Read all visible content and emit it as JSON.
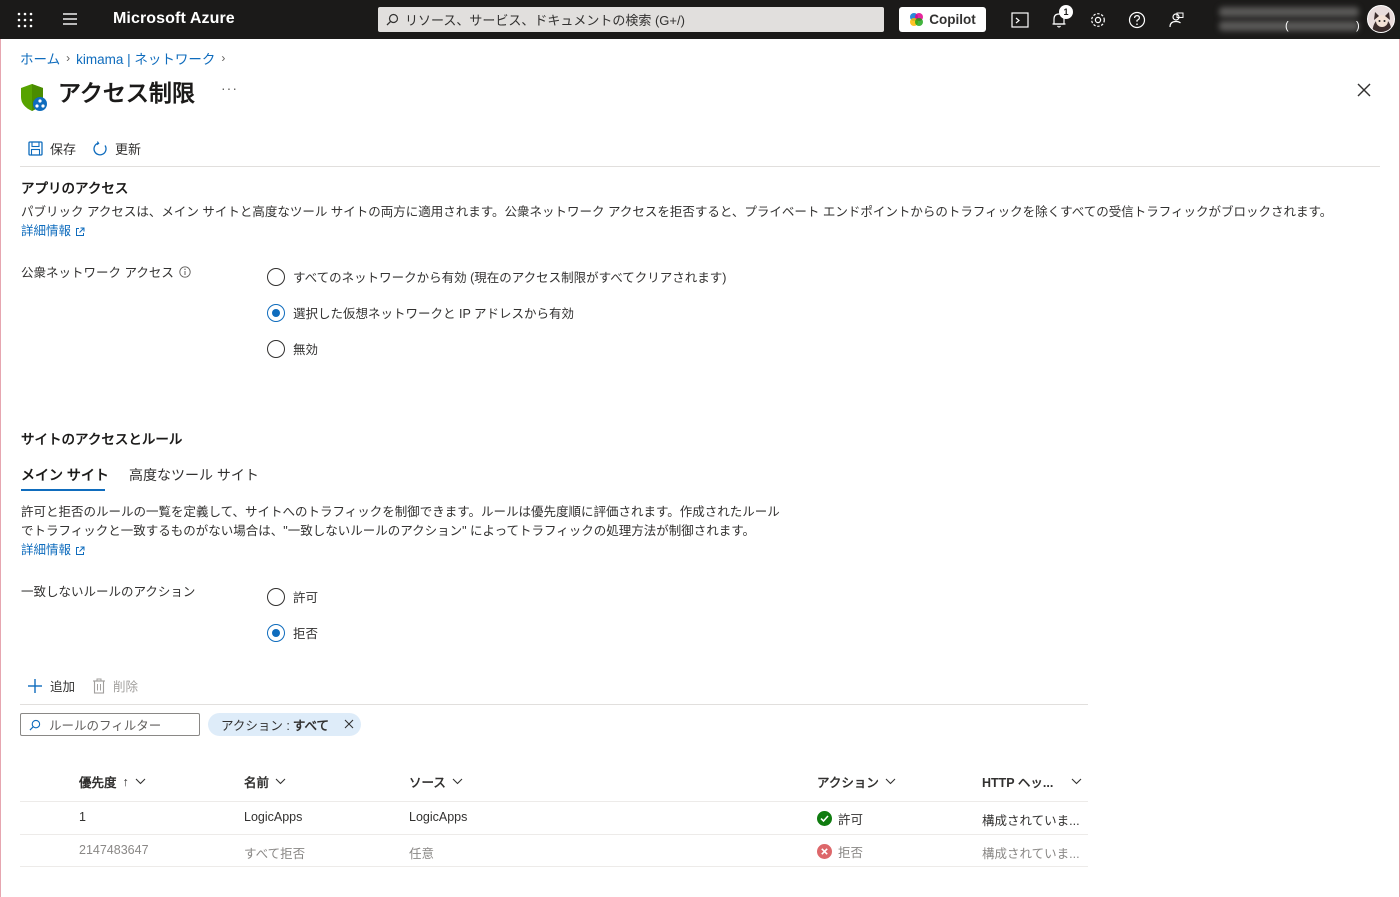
{
  "topbar": {
    "brand": "Microsoft Azure",
    "search_placeholder": "リソース、サービス、ドキュメントの検索 (G+/)",
    "copilot_label": "Copilot",
    "notification_count": "1",
    "paren_open": "(",
    "paren_close": ")"
  },
  "breadcrumb": {
    "home": "ホーム",
    "parent": "kimama | ネットワーク"
  },
  "page": {
    "title": "アクセス制限",
    "more": "···"
  },
  "toolbar": {
    "save_label": "保存",
    "refresh_label": "更新"
  },
  "app_access": {
    "heading": "アプリのアクセス",
    "description": "パブリック アクセスは、メイン サイトと高度なツール サイトの両方に適用されます。公衆ネットワーク アクセスを拒否すると、プライベート エンドポイントからのトラフィックを除くすべての受信トラフィックがブロックされます。",
    "learn_more": "詳細情報",
    "field_label": "公衆ネットワーク アクセス",
    "options": [
      {
        "label": "すべてのネットワークから有効 (現在のアクセス制限がすべてクリアされます)",
        "checked": false
      },
      {
        "label": "選択した仮想ネットワークと IP アドレスから有効",
        "checked": true
      },
      {
        "label": "無効",
        "checked": false
      }
    ]
  },
  "site_access": {
    "heading": "サイトのアクセスとルール",
    "tabs": [
      {
        "label": "メイン サイト",
        "active": true
      },
      {
        "label": "高度なツール サイト",
        "active": false
      }
    ],
    "description_line1": "許可と拒否のルールの一覧を定義して、サイトへのトラフィックを制御できます。ルールは優先度順に評価されます。作成されたルール",
    "description_line2": "でトラフィックと一致するものがない場合は、\"一致しないルールのアクション\" によってトラフィックの処理方法が制御されます。",
    "learn_more": "詳細情報",
    "unmatched_label": "一致しないルールのアクション",
    "unmatched_options": [
      {
        "label": "許可",
        "checked": false
      },
      {
        "label": "拒否",
        "checked": true
      }
    ]
  },
  "rules": {
    "add_label": "追加",
    "delete_label": "削除",
    "filter_placeholder": "ルールのフィルター",
    "pill_key": "アクション :",
    "pill_value": "すべて",
    "columns": {
      "priority": "優先度",
      "priority_sort": "↑",
      "name": "名前",
      "source": "ソース",
      "action": "アクション",
      "http": "HTTP ヘッ..."
    },
    "rows": [
      {
        "priority": "1",
        "name": "LogicApps",
        "source": "LogicApps",
        "action": "許可",
        "action_type": "allow",
        "http": "構成されていま..."
      },
      {
        "priority": "2147483647",
        "name": "すべて拒否",
        "source": "任意",
        "action": "拒否",
        "action_type": "deny",
        "http": "構成されていま..."
      }
    ]
  },
  "colors": {
    "accent": "#0f6cbd",
    "topbar": "#1b1a19",
    "allow": "#107c10",
    "deny": "#d13438"
  }
}
